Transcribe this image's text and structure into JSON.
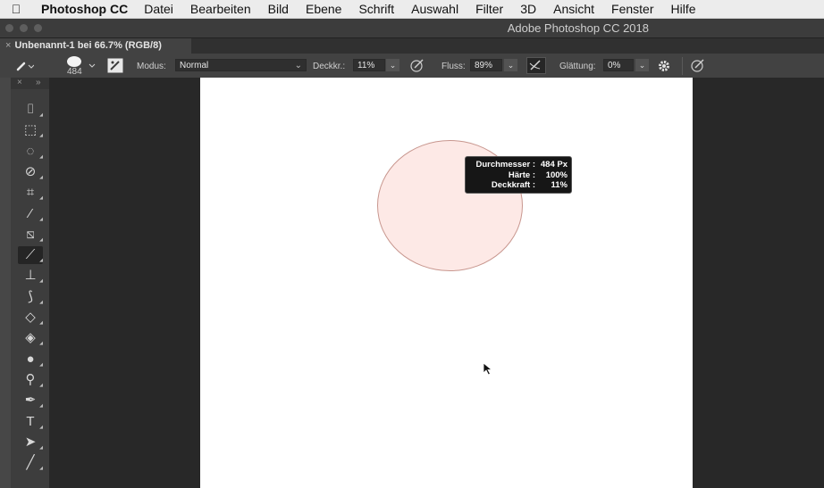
{
  "menubar": {
    "app_name": "Photoshop CC",
    "items": [
      "Datei",
      "Bearbeiten",
      "Bild",
      "Ebene",
      "Schrift",
      "Auswahl",
      "Filter",
      "3D",
      "Ansicht",
      "Fenster",
      "Hilfe"
    ]
  },
  "window": {
    "title": "Adobe Photoshop CC 2018"
  },
  "document_tab": {
    "label": "Unbenannt-1 bei 66.7% (RGB/8)",
    "close": "×"
  },
  "options": {
    "brush_size": "484",
    "modus_label": "Modus:",
    "modus_value": "Normal",
    "opacity_label": "Deckkr.:",
    "opacity_value": "11%",
    "flow_label": "Fluss:",
    "flow_value": "89%",
    "smoothing_label": "Glättung:",
    "smoothing_value": "0%"
  },
  "tools_header": {
    "close": "×",
    "expand": "»"
  },
  "tools": [
    {
      "name": "crop-artboard-tool-icon",
      "glyph": "⌷"
    },
    {
      "name": "marquee-tool-icon",
      "glyph": "⬚"
    },
    {
      "name": "lasso-tool-icon",
      "glyph": "◌"
    },
    {
      "name": "quick-select-tool-icon",
      "glyph": "⊘"
    },
    {
      "name": "crop-tool-icon",
      "glyph": "⌗"
    },
    {
      "name": "eyedropper-tool-icon",
      "glyph": "⁄"
    },
    {
      "name": "healing-brush-tool-icon",
      "glyph": "⧅"
    },
    {
      "name": "brush-tool-icon",
      "glyph": "⟋"
    },
    {
      "name": "clone-stamp-tool-icon",
      "glyph": "⊥"
    },
    {
      "name": "history-brush-tool-icon",
      "glyph": "⟆"
    },
    {
      "name": "eraser-tool-icon",
      "glyph": "◇"
    },
    {
      "name": "paint-bucket-tool-icon",
      "glyph": "◈"
    },
    {
      "name": "blur-tool-icon",
      "glyph": "●"
    },
    {
      "name": "dodge-tool-icon",
      "glyph": "⚲"
    },
    {
      "name": "pen-tool-icon",
      "glyph": "✒"
    },
    {
      "name": "type-tool-icon",
      "glyph": "T"
    },
    {
      "name": "path-selection-tool-icon",
      "glyph": "➤"
    },
    {
      "name": "line-tool-icon",
      "glyph": "╱"
    }
  ],
  "tooltip": {
    "diameter_label": "Durchmesser :",
    "diameter_value": "484 Px",
    "hardness_label": "Härte :",
    "hardness_value": "100%",
    "opacity_label": "Deckkraft :",
    "opacity_value": "11%"
  },
  "colors": {
    "brush_fill": "#fde9e6",
    "brush_outline": "#c8978f"
  }
}
